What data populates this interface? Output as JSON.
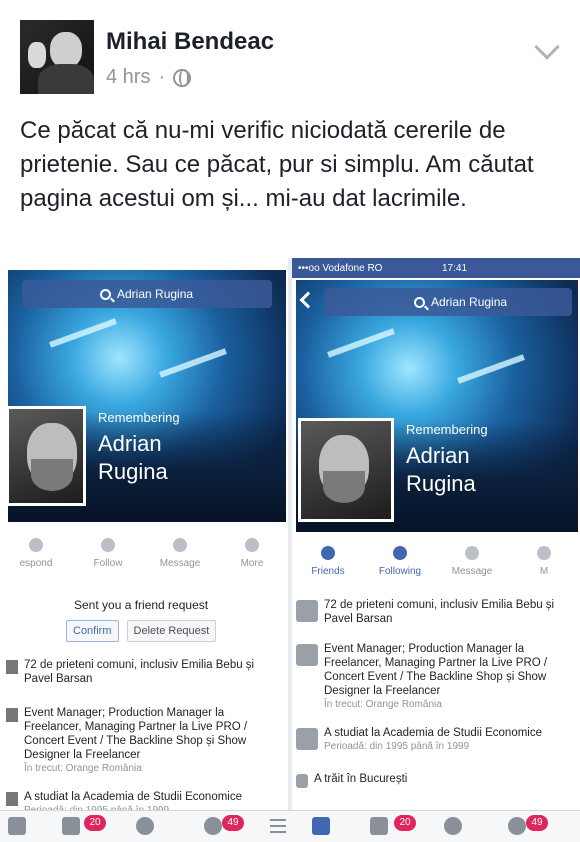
{
  "post": {
    "author": "Mihai Bendeac",
    "time": "4 hrs",
    "separator": "·",
    "text": "Ce păcat că nu-mi verific niciodată cererile de prietenie. Sau ce păcat, pur si simplu. Am căutat pagina acestui om și... mi-au dat lacrimile.",
    "menu_icon": "chevron-down-icon"
  },
  "left_shot": {
    "search": "Adrian Rugina",
    "remembering": "Remembering",
    "name": "Adrian Rugina",
    "actions": [
      "espond",
      "Follow",
      "Message",
      "More"
    ],
    "request_text": "Sent you a friend request",
    "confirm": "Confirm",
    "delete": "Delete Request",
    "mutual": "72 de prieteni comuni, inclusiv Emilia Bebu și Pavel Barsan",
    "work": "Event Manager; Production Manager la Freelancer, Managing Partner la Live PRO / Concert Event / The Backline Shop și Show Designer la Freelancer",
    "work_sub": "În trecut: Orange România",
    "study": "A studiat la Academia de Studii Economice",
    "study_sub": "Perioadă: din 1995 până în 1999",
    "badge_friends": "20",
    "badge_notifications": "49"
  },
  "right_shot": {
    "carrier": "•••oo Vodafone RO",
    "time": "17:41",
    "search": "Adrian Rugina",
    "remembering": "Remembering",
    "name": "Adrian Rugina",
    "actions": [
      "Friends",
      "Following",
      "Message",
      "M"
    ],
    "mutual": "72 de prieteni comuni, inclusiv Emilia Bebu și Pavel Barsan",
    "work": "Event Manager; Production Manager la Freelancer, Managing Partner la Live PRO / Concert Event / The Backline Shop și Show Designer la Freelancer",
    "work_sub": "În trecut: Orange România",
    "study": "A studiat la Academia de Studii Economice",
    "study_sub": "Perioadă: din 1995 până în 1999",
    "lived": "A trăit în București",
    "badge_friends": "20",
    "badge_notifications": "49"
  }
}
